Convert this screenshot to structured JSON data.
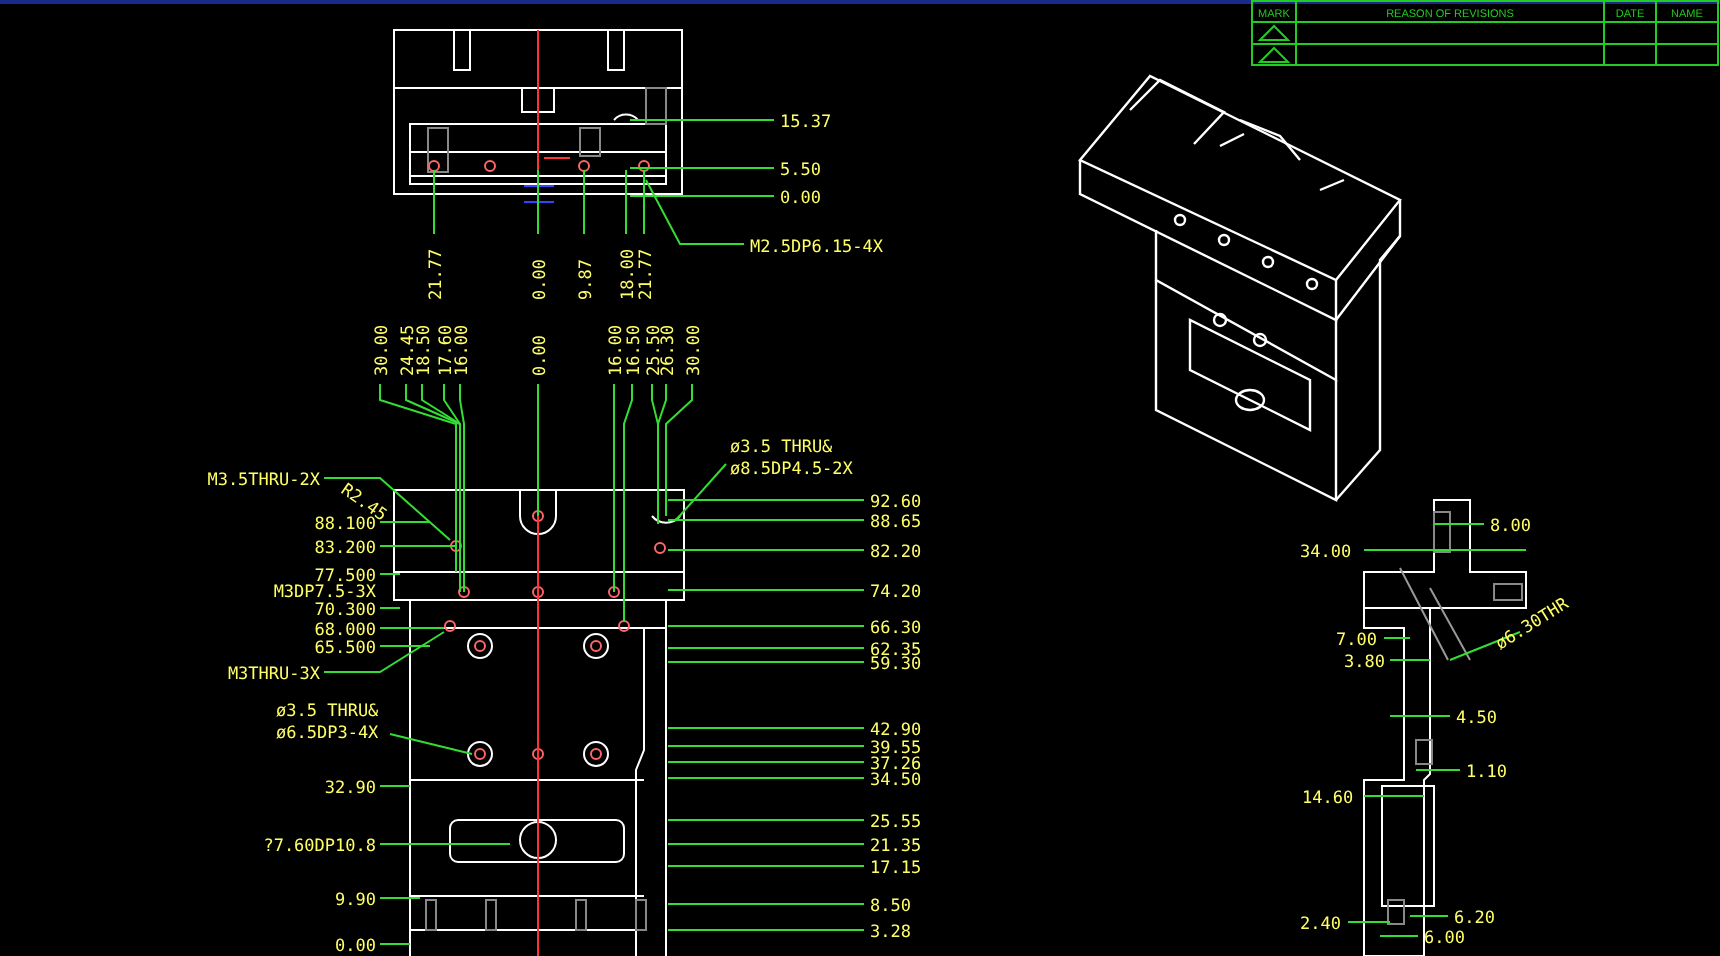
{
  "revision_table": {
    "columns": [
      "MARK",
      "REASON OF REVISIONS",
      "DATE",
      "NAME"
    ],
    "rows": [
      {
        "kind": "revision"
      },
      {
        "kind": "revision"
      }
    ]
  },
  "top_view": {
    "right_dims": [
      "15.37",
      "5.50",
      "0.00"
    ],
    "bottom_dims": [
      "21.77",
      "0.00",
      "9.87",
      "18.00",
      "21.77"
    ],
    "callout": "M2.5DP6.15-4X"
  },
  "front_view": {
    "top_dims": [
      "30.00",
      "24.45",
      "18.50",
      "17.60",
      "16.00",
      "0.00",
      "16.00",
      "16.50",
      "25.50",
      "26.30",
      "30.00"
    ],
    "left_dims": [
      "88.100",
      "83.200",
      "77.500",
      "70.300",
      "68.000",
      "65.500",
      "32.90",
      "?7.60DP10.8",
      "9.90",
      "0.00"
    ],
    "left_callouts": [
      "M3.5THRU-2X",
      "M3DP7.5-3X",
      "M3THRU-3X",
      "ø3.5 THRU&",
      "ø6.5DP3-4X"
    ],
    "radius": "R2.45",
    "right_callout": [
      "ø3.5 THRU&",
      "ø8.5DP4.5-2X"
    ],
    "right_dims": [
      "92.60",
      "88.65",
      "82.20",
      "74.20",
      "66.30",
      "62.35",
      "59.30",
      "42.90",
      "39.55",
      "37.26",
      "34.50",
      "25.55",
      "21.35",
      "17.15",
      "8.50",
      "3.28"
    ]
  },
  "side_view": {
    "dims": [
      "8.00",
      "34.00",
      "7.00",
      "3.80",
      "4.50",
      "1.10",
      "14.60",
      "2.40",
      "6.20",
      "6.00"
    ],
    "hole_callout": "ø6.30THR"
  }
}
